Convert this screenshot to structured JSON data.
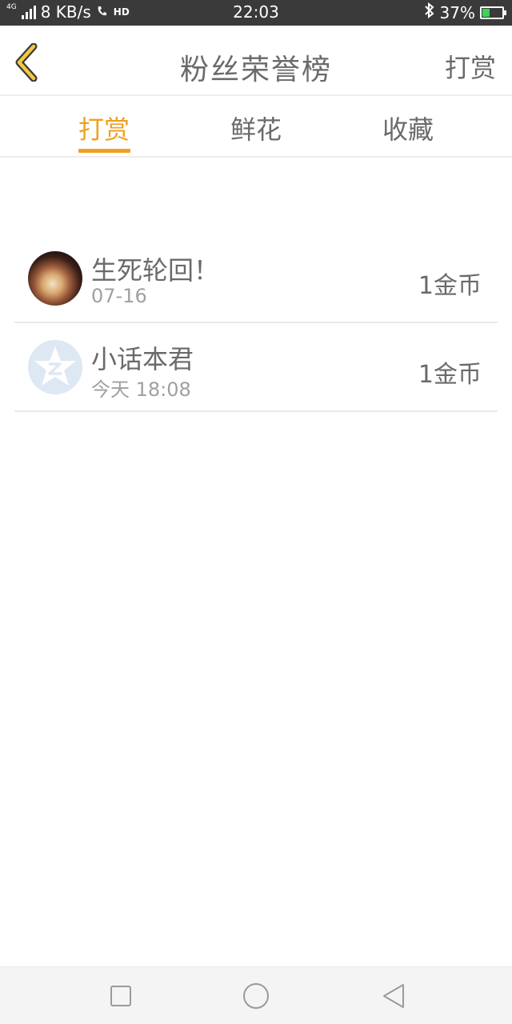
{
  "status_bar": {
    "network_type": "4G",
    "speed": "8 KB/s",
    "hd": "HD",
    "time": "22:03",
    "battery": "37%",
    "battery_level": 0.37,
    "icons": [
      "signal-icon",
      "call-hd-icon",
      "bluetooth-icon",
      "battery-icon"
    ]
  },
  "header": {
    "title": "粉丝荣誉榜",
    "action_label": "打赏",
    "back_icon": "chevron-left-icon",
    "accent_color": "#f0a020"
  },
  "tabs": [
    {
      "label": "打赏",
      "active": true
    },
    {
      "label": "鲜花",
      "active": false
    },
    {
      "label": "收藏",
      "active": false
    }
  ],
  "list": [
    {
      "name": "生死轮回！",
      "date": "07-16",
      "amount": "1金币",
      "avatar": "photo-avatar"
    },
    {
      "name": "小话本君",
      "date": "今天 18:08",
      "amount": "1金币",
      "avatar": "default-star-avatar"
    }
  ],
  "nav_bar": {
    "buttons": [
      "recent-apps-icon",
      "home-icon",
      "back-triangle-icon"
    ]
  }
}
